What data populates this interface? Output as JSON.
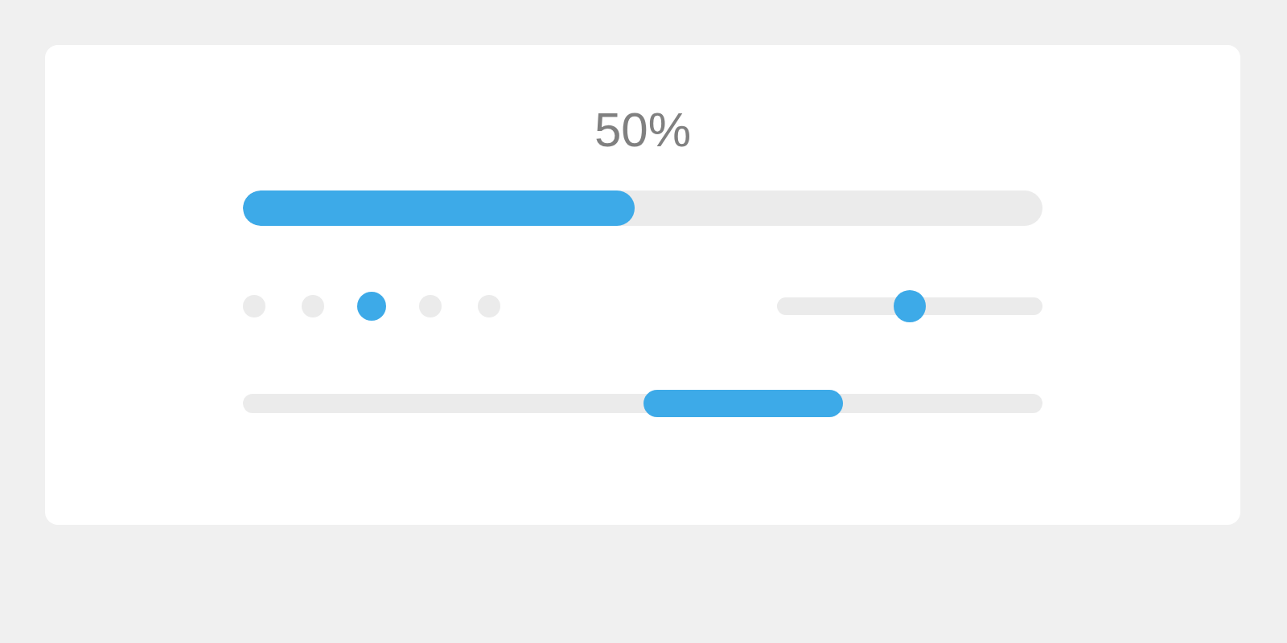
{
  "progress": {
    "label": "50%",
    "level": 0.49
  },
  "pager": {
    "dots": [
      {
        "selected": false
      },
      {
        "selected": false
      },
      {
        "selected": true
      },
      {
        "selected": false
      },
      {
        "selected": false
      }
    ]
  },
  "slider": {
    "level": 0.5
  },
  "loader": {
    "kind": "indeterminate"
  }
}
